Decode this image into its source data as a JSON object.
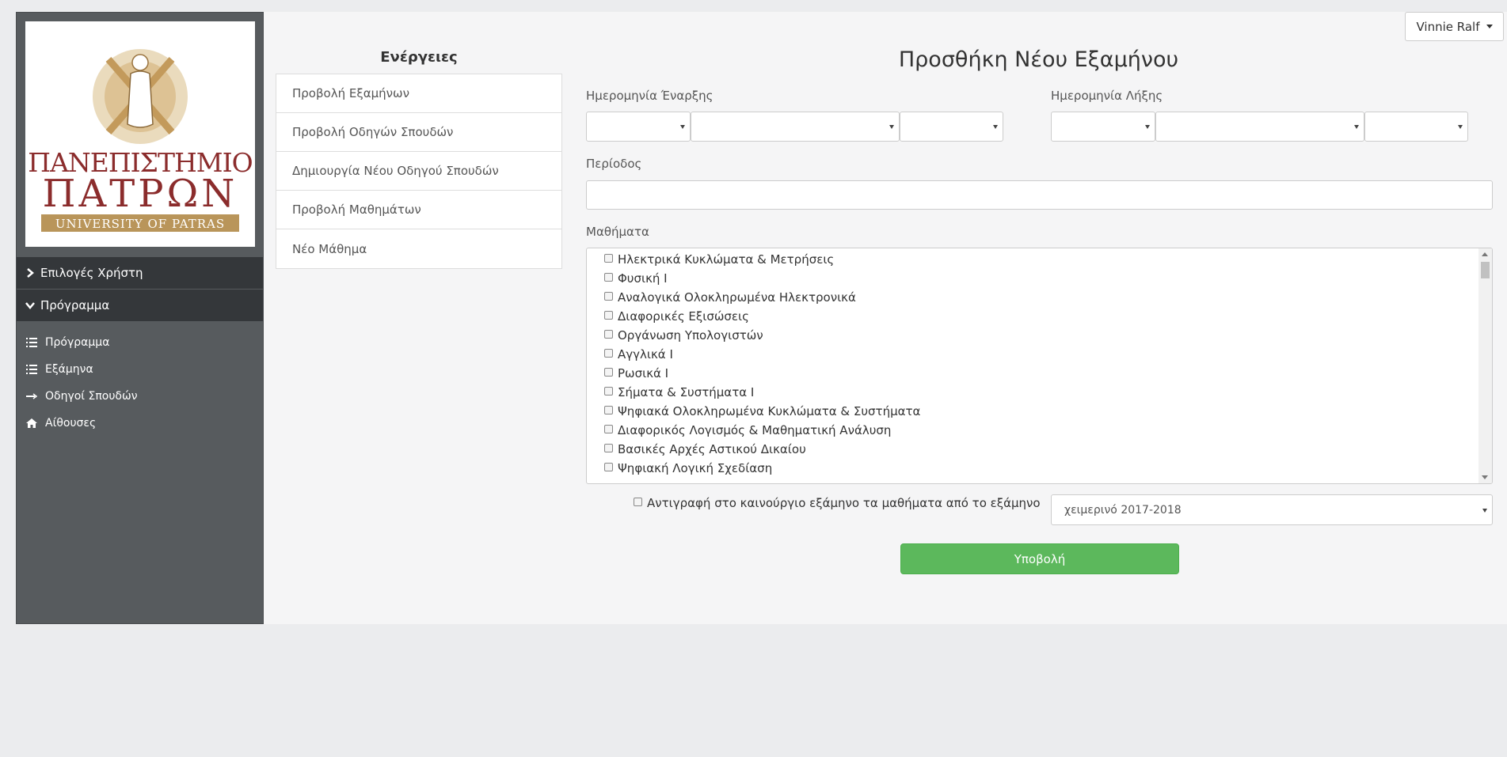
{
  "user": {
    "name": "Vinnie Ralf"
  },
  "logo": {
    "line1": "ΠΑΝΕΠΙΣΤΗΜΙΟ",
    "line2": "ΠΑΤΡΩΝ",
    "line3": "UNIVERSITY OF PATRAS",
    "color": "#8b2c2c",
    "accent": "#b9955a"
  },
  "sidebar": {
    "sections": [
      {
        "label": "Επιλογές Χρήστη",
        "icon": "chevron-right-icon"
      },
      {
        "label": "Πρόγραμμα",
        "icon": "chevron-down-icon"
      }
    ],
    "items": [
      {
        "label": "Πρόγραμμα",
        "icon": "list-icon"
      },
      {
        "label": "Εξάμηνα",
        "icon": "list-icon"
      },
      {
        "label": "Οδηγοί Σπουδών",
        "icon": "arrow-right-icon"
      },
      {
        "label": "Αίθουσες",
        "icon": "home-icon"
      }
    ]
  },
  "actions": {
    "title": "Ενέργειες",
    "items": [
      "Προβολή Εξαμήνων",
      "Προβολή Οδηγών Σπουδών",
      "Δημιουργία Νέου Οδηγού Σπουδών",
      "Προβολή Μαθημάτων",
      "Νέο Μάθημα"
    ]
  },
  "form": {
    "title": "Προσθήκη Νέου Εξαμήνου",
    "start_date_label": "Ημερομηνία Έναρξης",
    "end_date_label": "Ημερομηνία Λήξης",
    "period_label": "Περίοδος",
    "period_value": "",
    "courses_label": "Μαθήματα",
    "courses": [
      "Ηλεκτρικά Κυκλώματα & Μετρήσεις",
      "Φυσική Ι",
      "Αναλογικά Ολοκληρωμένα Ηλεκτρονικά",
      "Διαφορικές Εξισώσεις",
      "Οργάνωση Υπολογιστών",
      "Αγγλικά Ι",
      "Ρωσικά Ι",
      "Σήματα & Συστήματα Ι",
      "Ψηφιακά Ολοκληρωμένα Κυκλώματα & Συστήματα",
      "Διαφορικός Λογισμός & Μαθηματική Ανάλυση",
      "Βασικές Αρχές Αστικού Δικαίου",
      "Ψηφιακή Λογική Σχεδίαση"
    ],
    "copy_label": "Αντιγραφή στο καινούργιο εξάμηνο τα μαθήματα από το εξάμηνο",
    "copy_semester_value": "χειμερινό 2017-2018",
    "submit_label": "Υποβολή",
    "submit_color": "#5cb85c"
  }
}
